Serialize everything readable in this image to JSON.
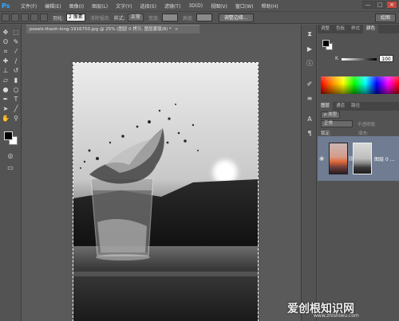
{
  "menubar": {
    "logo": "Ps",
    "items": [
      "文件(F)",
      "编辑(E)",
      "图像(I)",
      "图层(L)",
      "文字(Y)",
      "选择(S)",
      "滤镜(T)",
      "3D(D)",
      "视图(V)",
      "窗口(W)",
      "帮助(H)"
    ]
  },
  "window_controls": [
    "—",
    "□",
    "×"
  ],
  "options_bar": {
    "feather_label": "羽化:",
    "feather_value": "2 像素",
    "antialias_label": "消除锯齿",
    "style_label": "样式:",
    "style_value": "正常",
    "width_label": "宽度:",
    "height_label": "高度:",
    "refine_button": "调整边缘...",
    "workspace": "绘图"
  },
  "document": {
    "tab_title": "pexels-thanh-long-1916750.jpg @ 25% (图层 0 拷贝, 图层蒙版/8) *"
  },
  "color_panel": {
    "tabs": [
      "调整",
      "色板",
      "样式",
      "颜色"
    ],
    "active_tab": "颜色",
    "k_label": "K",
    "k_value": "100"
  },
  "layers_panel": {
    "tabs": [
      "图层",
      "通道",
      "路径"
    ],
    "kind_label": "ρ 类型",
    "blend_mode": "正常",
    "opacity_label": "不透明度:",
    "lock_label": "锁定:",
    "fill_label": "填充:",
    "layer_name": "图层 0 ..."
  },
  "watermark": {
    "text": "爱创根知识网",
    "sub": "www.zhishiwu.com"
  }
}
